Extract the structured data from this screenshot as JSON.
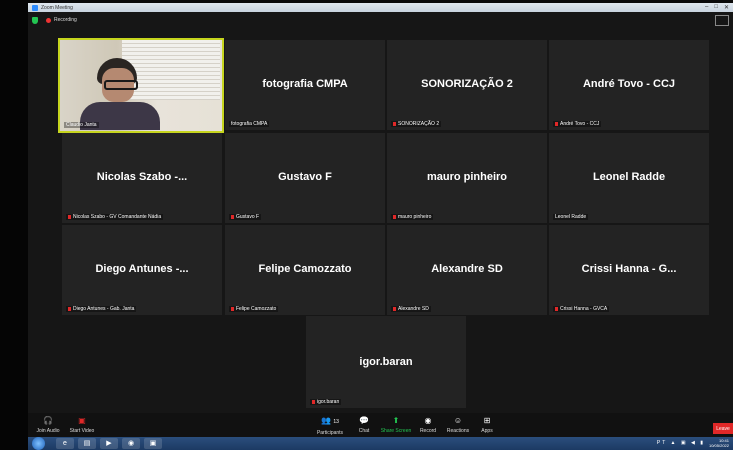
{
  "window": {
    "title": "Zoom Meeting",
    "recording_label": "Recording"
  },
  "participants": [
    {
      "display": "",
      "name": "Claudio Janta",
      "muted": false,
      "video": true
    },
    {
      "display": "fotografia CMPA",
      "name": "fotografia CMPA",
      "muted": false
    },
    {
      "display": "SONORIZAÇÃO 2",
      "name": "SONORIZAÇÃO 2",
      "muted": true
    },
    {
      "display": "André Tovo - CCJ",
      "name": "André Tovo - CCJ",
      "muted": true
    },
    {
      "display": "Nicolas Szabo -...",
      "name": "Nicolas Szabo - GV Comandante Nádia",
      "muted": true
    },
    {
      "display": "Gustavo F",
      "name": "Gustavo F",
      "muted": true
    },
    {
      "display": "mauro pinheiro",
      "name": "mauro pinheiro",
      "muted": true
    },
    {
      "display": "Leonel Radde",
      "name": "Leonel Radde",
      "muted": false
    },
    {
      "display": "Diego Antunes -...",
      "name": "Diego Antunes - Gab. Janta",
      "muted": true
    },
    {
      "display": "Felipe Camozzato",
      "name": "Felipe Camozzato",
      "muted": true
    },
    {
      "display": "Alexandre SD",
      "name": "Alexandre SD",
      "muted": true
    },
    {
      "display": "Crissi Hanna - G...",
      "name": "Crissi Hanna - GVCA",
      "muted": true
    },
    {
      "display": "igor.baran",
      "name": "igor.baran",
      "muted": true
    }
  ],
  "toolbar": {
    "join_audio": "Join Audio",
    "start_video": "Start Video",
    "participants": "Participants",
    "participants_count": "13",
    "chat": "Chat",
    "share_screen": "Share Screen",
    "record": "Record",
    "reactions": "Reactions",
    "apps": "Apps",
    "leave": "Leave"
  },
  "taskbar": {
    "language": "PT",
    "time": "10:41",
    "date": "10/05/2022"
  },
  "colors": {
    "tile_bg": "#232323",
    "active_outline": "#c6d51e",
    "share_green": "#23c552",
    "leave_red": "#e02828"
  }
}
